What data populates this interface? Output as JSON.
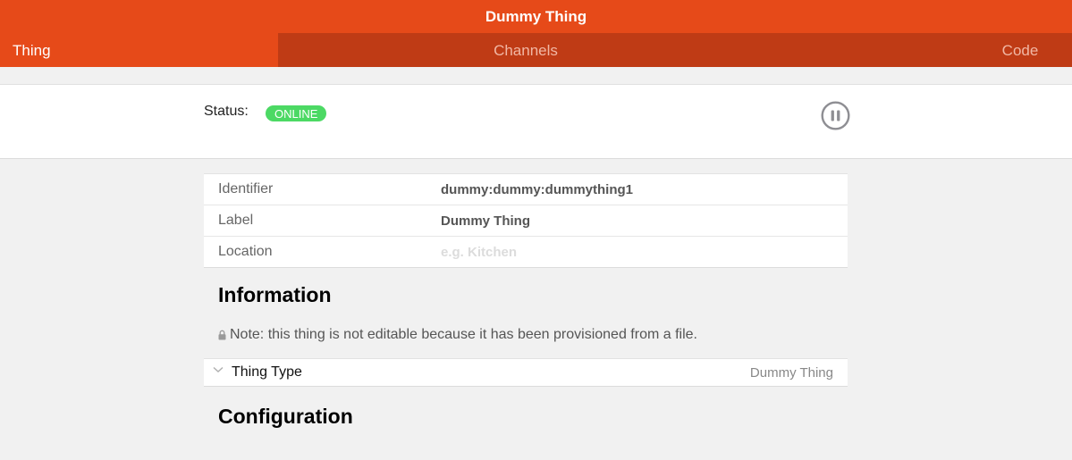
{
  "header": {
    "title": "Dummy Thing"
  },
  "tabs": [
    {
      "label": "Thing",
      "active": true
    },
    {
      "label": "Channels",
      "active": false
    },
    {
      "label": "Code",
      "active": false
    }
  ],
  "status": {
    "label": "Status:",
    "badge": "ONLINE",
    "badge_color": "#4cd964",
    "action_icon": "pause-icon"
  },
  "properties": [
    {
      "key": "Identifier",
      "value": "dummy:dummy:dummything1"
    },
    {
      "key": "Label",
      "value": "Dummy Thing"
    },
    {
      "key": "Location",
      "placeholder": "e.g. Kitchen"
    }
  ],
  "information": {
    "title": "Information",
    "note": "Note: this thing is not editable because it has been provisioned from a file.",
    "note_icon": "lock-icon"
  },
  "thing_type": {
    "label": "Thing Type",
    "value": "Dummy Thing",
    "icon": "chevron-down-icon"
  },
  "configuration": {
    "title": "Configuration"
  },
  "colors": {
    "accent": "#e64a19",
    "tab_bar": "#bf3b15",
    "background": "#f1f1f1"
  }
}
